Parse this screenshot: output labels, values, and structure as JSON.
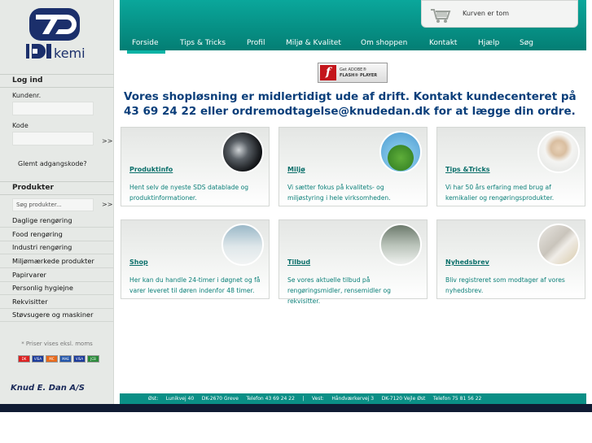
{
  "logo": {
    "text": "kemi",
    "brand": "Knud E. Dan A/S"
  },
  "login": {
    "title": "Log ind",
    "customer_label": "Kundenr.",
    "code_label": "Kode",
    "go": ">>",
    "forgot": "Glemt adgangskode?"
  },
  "products": {
    "title": "Produkter",
    "search_placeholder": "Søg produkter...",
    "go": ">>",
    "categories": [
      "Daglige rengøring",
      "Food rengøring",
      "Industri rengøring",
      "Miljømærkede produkter",
      "Papirvarer",
      "Personlig hygiejne",
      "Rekvisitter",
      "Støvsugere og maskiner"
    ]
  },
  "price_note": "* Priser vises eksl. moms",
  "payment_cards": [
    "DK",
    "VISA",
    "MC",
    "MAE",
    "VISA",
    "JCB"
  ],
  "cart": {
    "text": "Kurven er tom"
  },
  "nav": [
    "Forside",
    "Tips & Tricks",
    "Profil",
    "Miljø & Kvalitet",
    "Om shoppen",
    "Kontakt",
    "Hjælp",
    "Søg"
  ],
  "flash": {
    "line1": "Get ADOBE®",
    "line2": "FLASH® PLAYER"
  },
  "notice": "Vores shopløsning er midlertidigt ude af drift. Kontakt kundecenteret på 43 69 24 22 eller ordremodtagelse@knudedan.dk for at lægge din ordre.",
  "boxes": [
    {
      "title": "Produktinfo",
      "text": "Hent selv de nyeste SDS datablade og produktinformationer."
    },
    {
      "title": "Miljø",
      "text": "Vi sætter fokus på kvalitets- og miljøstyring i hele virksomheden."
    },
    {
      "title": "Tips &Tricks",
      "text": "Vi har 50 års erfaring med brug af kemikalier og rengøringsprodukter."
    },
    {
      "title": "Shop",
      "text": "Her kan du handle 24-timer i døgnet og få varer leveret til døren indenfor 48 timer."
    },
    {
      "title": "Tilbud",
      "text": "Se vores aktuelle tilbud på rengøringsmidler, rensemidler og rekvisitter."
    },
    {
      "title": "Nyhedsbrev",
      "text": "Bliv registreret som modtager af vores nyhedsbrev."
    }
  ],
  "footer": "Øst:     Lunikvej 40     DK-2670 Greve     Telefon 43 69 24 22     |     Vest:     Håndværkervej 3     DK-7120 Vejle Øst     Telefon 75 81 56 22",
  "colors": {
    "accent": "#047e74",
    "notice": "#0a3e7a",
    "sidebar": "#e6e9e6"
  }
}
